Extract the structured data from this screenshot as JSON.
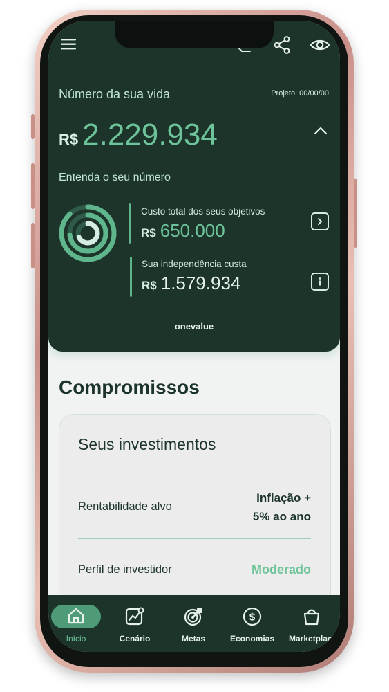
{
  "header": {
    "title": "Número da sua vida",
    "projeto": "Projeto: 00/00/00",
    "currency": "R$",
    "life_number": "2.229.934",
    "subtitle": "Entenda o seu número"
  },
  "breakdown": {
    "objectives_label": "Custo total dos seus objetivos",
    "objectives_value": "650.000",
    "independence_label": "Sua independência custa",
    "independence_value": "1.579.934"
  },
  "brand": "onevalue",
  "compromissos": {
    "title": "Compromissos",
    "card_title": "Seus investimentos",
    "rentabilidade_label": "Rentabilidade alvo",
    "rentabilidade_value_line1": "Inflação +",
    "rentabilidade_value_line2": "5% ao ano",
    "perfil_label": "Perfil de investidor",
    "perfil_value": "Moderado"
  },
  "nav": [
    {
      "label": "Início",
      "icon": "home-icon",
      "active": true
    },
    {
      "label": "Cenário",
      "icon": "chart-icon",
      "active": false
    },
    {
      "label": "Metas",
      "icon": "target-icon",
      "active": false
    },
    {
      "label": "Economias",
      "icon": "coin-icon",
      "active": false
    },
    {
      "label": "Marketplace",
      "icon": "bag-icon",
      "active": false
    }
  ],
  "colors": {
    "dark_green": "#1c342a",
    "accent_green": "#6ec49a",
    "light_bg": "#f1f3f2"
  }
}
